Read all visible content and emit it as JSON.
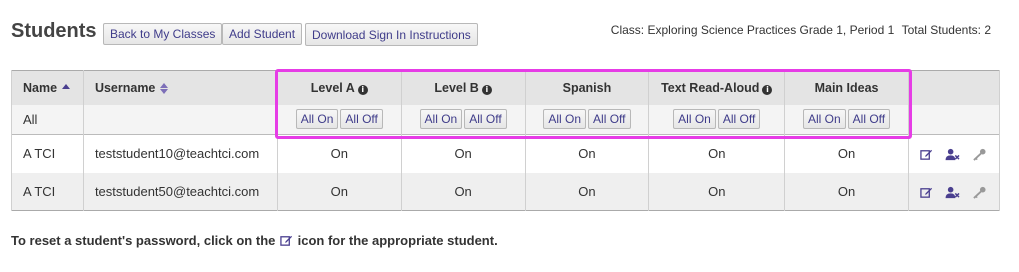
{
  "header": {
    "title": "Students",
    "buttons": {
      "back": "Back to My Classes",
      "add": "Add Student",
      "download": "Download Sign In Instructions"
    },
    "class_label": "Class: Exploring Science Practices Grade 1, Period 1",
    "total_label": "Total Students: 2"
  },
  "table": {
    "columns": {
      "name": "Name",
      "username": "Username",
      "level_a": "Level A",
      "level_b": "Level B",
      "spanish": "Spanish",
      "text_read_aloud": "Text Read-Aloud",
      "main_ideas": "Main Ideas"
    },
    "filter": {
      "all_label": "All",
      "all_on": "All On",
      "all_off": "All Off"
    },
    "rows": [
      {
        "name": "A TCI",
        "username": "teststudent10@teachtci.com",
        "level_a": "On",
        "level_b": "On",
        "spanish": "On",
        "text_read_aloud": "On",
        "main_ideas": "On"
      },
      {
        "name": "A TCI",
        "username": "teststudent50@teachtci.com",
        "level_a": "On",
        "level_b": "On",
        "spanish": "On",
        "text_read_aloud": "On",
        "main_ideas": "On"
      }
    ]
  },
  "footer": {
    "before": "To reset a student's password, click on the",
    "after": "icon for the appropriate student."
  },
  "colors": {
    "accent": "#3f3c8a",
    "highlight": "#e63ce6",
    "icon": "#4a3f8f"
  }
}
